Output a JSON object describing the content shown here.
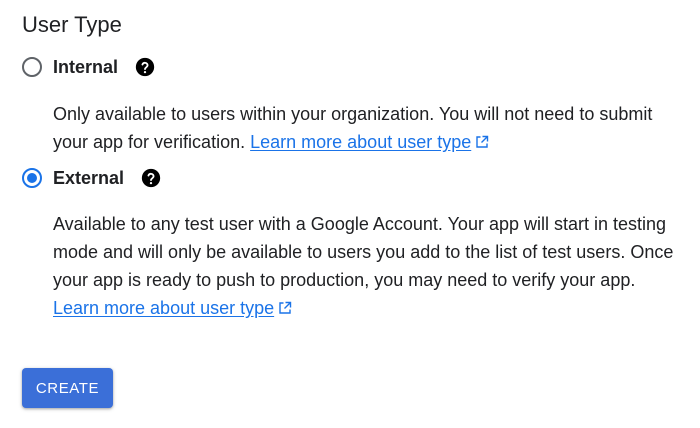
{
  "section": {
    "title": "User Type"
  },
  "options": {
    "internal": {
      "label": "Internal",
      "selected": false,
      "description": "Only available to users within your organization. You will not need to submit your app for verification.",
      "link_text": "Learn more about user type"
    },
    "external": {
      "label": "External",
      "selected": true,
      "description": "Available to any test user with a Google Account. Your app will start in testing mode and will only be available to users you add to the list of test users. Once your app is ready to push to production, you may need to verify your app.",
      "link_text": "Learn more about user type"
    }
  },
  "actions": {
    "create_label": "CREATE"
  },
  "colors": {
    "accent": "#1a73e8",
    "button": "#3b6fd8",
    "radio_unselected": "#5f6368",
    "text": "#202124"
  },
  "icons": {
    "help": "help-circle-icon",
    "external_link": "open-in-new-icon"
  }
}
